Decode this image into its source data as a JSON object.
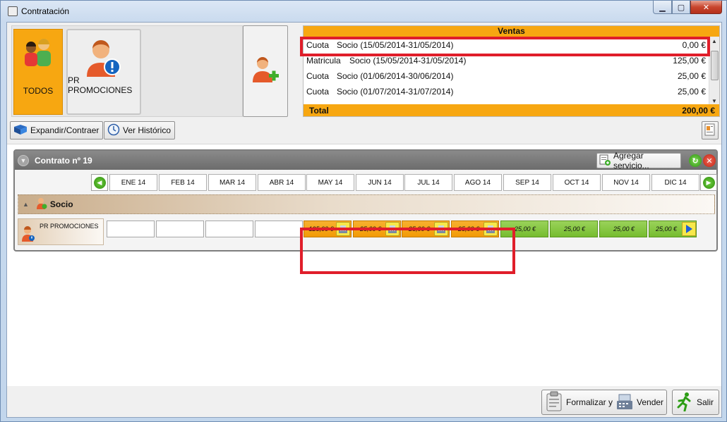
{
  "window": {
    "title": "Contratación"
  },
  "profiles": [
    {
      "label": "TODOS",
      "icon": "group-people-icon"
    },
    {
      "label": "PR PROMOCIONES",
      "icon": "person-alert-icon"
    }
  ],
  "add_client_icon": "add-person-icon",
  "ventas": {
    "title": "Ventas",
    "rows": [
      {
        "type": "Cuota",
        "desc": "Socio (15/05/2014-31/05/2014)",
        "amount": "0,00 €"
      },
      {
        "type": "Matricula",
        "desc": "Socio (15/05/2014-31/05/2014)",
        "amount": "125,00 €"
      },
      {
        "type": "Cuota",
        "desc": "Socio (01/06/2014-30/06/2014)",
        "amount": "25,00 €"
      },
      {
        "type": "Cuota",
        "desc": "Socio (01/07/2014-31/07/2014)",
        "amount": "25,00 €"
      }
    ],
    "total_label": "Total",
    "total_amount": "200,00 €"
  },
  "toolbar": {
    "expand_label": "Expandir/Contraer",
    "history_label": "Ver Histórico"
  },
  "contract": {
    "title": "Contrato nº 19",
    "add_service_label": "Agregar servicio...",
    "months": [
      "ENE 14",
      "FEB 14",
      "MAR 14",
      "ABR 14",
      "MAY 14",
      "JUN 14",
      "JUL 14",
      "AGO 14",
      "SEP 14",
      "OCT 14",
      "NOV 14",
      "DIC 14"
    ],
    "group_label": "Socio",
    "service": {
      "label": "PR PROMOCIONES",
      "cells": [
        {
          "value": "",
          "status": "empty"
        },
        {
          "value": "",
          "status": "empty"
        },
        {
          "value": "",
          "status": "empty"
        },
        {
          "value": "",
          "status": "empty"
        },
        {
          "value": "125,00 €",
          "status": "pending"
        },
        {
          "value": "25,00 €",
          "status": "pending"
        },
        {
          "value": "25,00 €",
          "status": "pending"
        },
        {
          "value": "25,00 €",
          "status": "pending"
        },
        {
          "value": "25,00 €",
          "status": "paid"
        },
        {
          "value": "25,00 €",
          "status": "paid"
        },
        {
          "value": "25,00 €",
          "status": "paid"
        },
        {
          "value": "25,00 €",
          "status": "paid"
        }
      ]
    }
  },
  "footer": {
    "formalize_label": "Formalizar y",
    "sell_label": "Vender",
    "exit_label": "Salir"
  },
  "colors": {
    "accent_orange": "#f7a711",
    "paid_green": "#86c43f",
    "highlight_red": "#e01e2a"
  }
}
